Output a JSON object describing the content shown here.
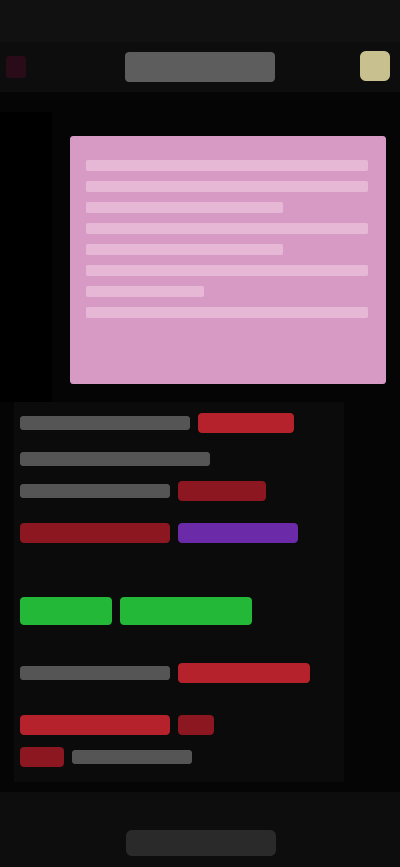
{
  "status_bar": {
    "time": "",
    "right": ""
  },
  "topbar": {
    "back_label": "",
    "title": ""
  },
  "sub_status": {
    "text": ""
  },
  "colors": {
    "background": "#050505",
    "pink_card": "#d69ac4",
    "highlight_red": "#b5222b",
    "highlight_green": "#24b838",
    "highlight_purple": "#6b2aa8"
  },
  "icons": {
    "avatar": "avatar-image"
  },
  "chat": {
    "rows": [
      {
        "text": ""
      },
      {
        "text": ""
      },
      {
        "text": ""
      },
      {
        "text": ""
      },
      {
        "text": ""
      },
      {
        "text": ""
      },
      {
        "text": ""
      },
      {
        "text": ""
      }
    ]
  },
  "input": {
    "send_label": ""
  }
}
